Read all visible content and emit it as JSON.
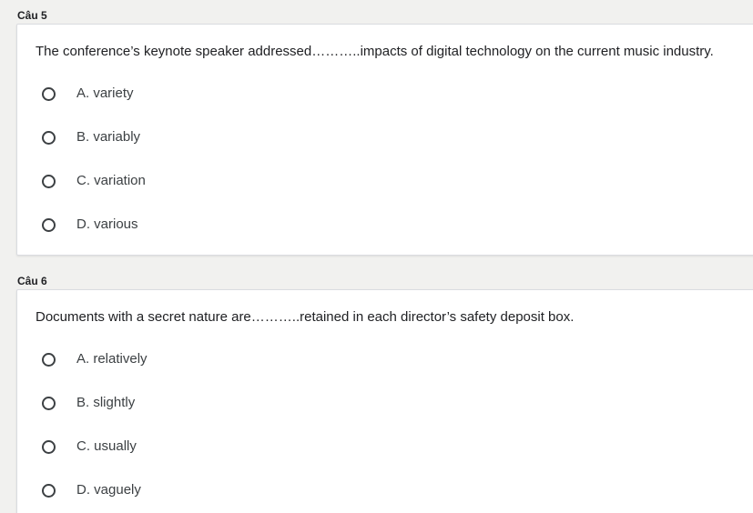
{
  "questions": [
    {
      "label": "Câu 5",
      "text": "The conference’s keynote speaker addressed………..impacts of digital technology on the current music industry.",
      "options": [
        "A. variety",
        "B. variably",
        "C. variation",
        "D. various"
      ]
    },
    {
      "label": "Câu 6",
      "text": "Documents with a secret nature are………..retained in each director’s safety deposit box.",
      "options": [
        "A. relatively",
        "B. slightly",
        "C. usually",
        "D. vaguely"
      ]
    }
  ]
}
